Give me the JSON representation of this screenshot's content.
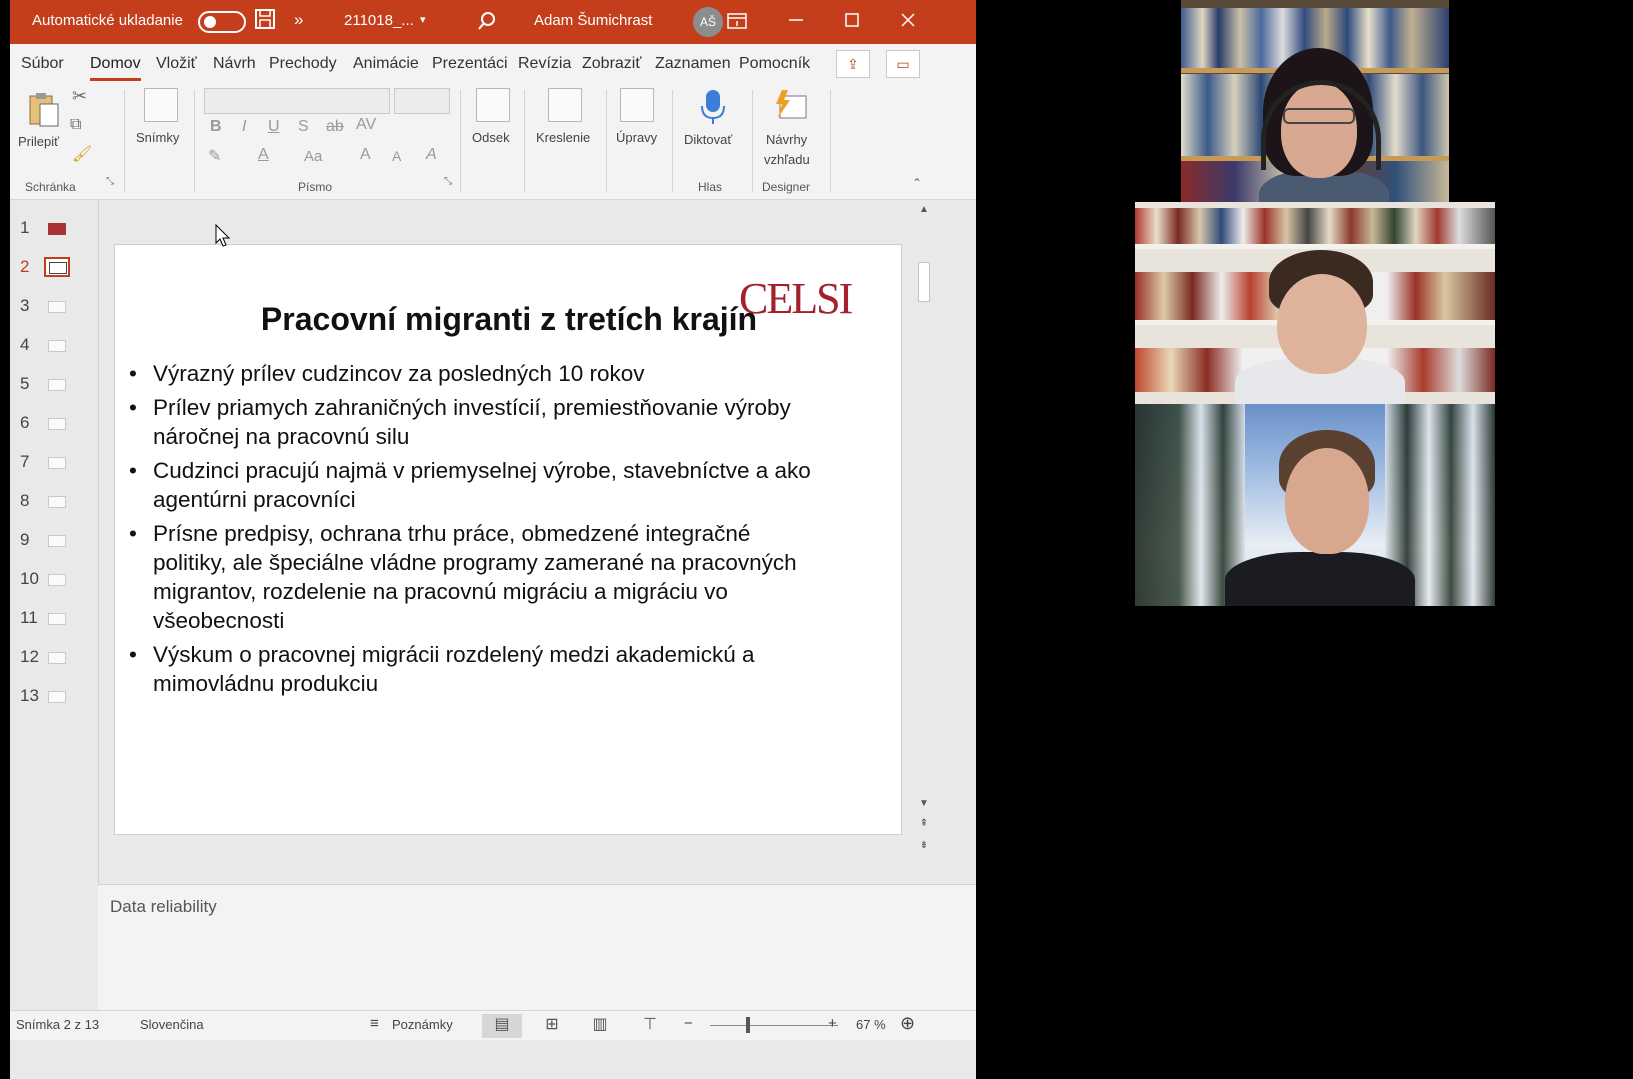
{
  "titlebar": {
    "autosave_label": "Automatické ukladanie",
    "more": "»",
    "filename": "211018_...",
    "filename_caret": "▾",
    "user_name": "Adam Šumichrast",
    "user_initials": "AŠ"
  },
  "tabs": [
    "Súbor",
    "Domov",
    "Vložiť",
    "Návrh",
    "Prechody",
    "Animácie",
    "Prezentáci",
    "Revízia",
    "Zobraziť",
    "Zaznamen",
    "Pomocník"
  ],
  "ribbon": {
    "paste_label": "Prilepiť",
    "clipboard_group": "Schránka",
    "slides_label": "Snímky",
    "font_group": "Písmo",
    "paragraph_label": "Odsek",
    "drawing_label": "Kreslenie",
    "editing_label": "Úpravy",
    "dictate_label": "Diktovať",
    "voice_group": "Hlas",
    "designer_label_1": "Návrhy",
    "designer_label_2": "vzhľadu",
    "designer_group": "Designer",
    "bold": "B",
    "italic": "I",
    "underline": "U",
    "shadow": "S",
    "strikethrough": "ab",
    "char_spacing": "AV",
    "change_case": "Aa",
    "grow_font": "A",
    "shrink_font": "A",
    "clear_format": "A"
  },
  "thumbnails": [
    {
      "num": "1",
      "style": "red"
    },
    {
      "num": "2",
      "style": "sel"
    },
    {
      "num": "3",
      "style": "plain"
    },
    {
      "num": "4",
      "style": "plain"
    },
    {
      "num": "5",
      "style": "plain"
    },
    {
      "num": "6",
      "style": "plain"
    },
    {
      "num": "7",
      "style": "plain"
    },
    {
      "num": "8",
      "style": "plain"
    },
    {
      "num": "9",
      "style": "plain"
    },
    {
      "num": "10",
      "style": "plain"
    },
    {
      "num": "11",
      "style": "plain"
    },
    {
      "num": "12",
      "style": "plain"
    },
    {
      "num": "13",
      "style": "plain"
    }
  ],
  "slide": {
    "title": "Pracovní migranti z tretích krajín",
    "logo": "CELSI",
    "bullets": [
      "Výrazný prílev cudzincov za posledných 10 rokov",
      "Prílev priamych zahraničných investícií, premiestňovanie výroby náročnej na pracovnú silu",
      "Cudzinci pracujú najmä v priemyselnej výrobe, stavebníctve a ako agentúrni pracovníci",
      "Prísne predpisy, ochrana trhu práce, obmedzené integračné politiky, ale špeciálne vládne programy zamerané na pracovných migrantov, rozdelenie na pracovnú migráciu a migráciu vo všeobecnosti",
      "Výskum o pracovnej migrácii rozdelený medzi akademickú a mimovládnu produkciu"
    ]
  },
  "notes": {
    "text": "Data reliability"
  },
  "status": {
    "slide_counter": "Snímka 2 z 13",
    "language": "Slovenčina",
    "notes_button": "Poznámky",
    "zoom_minus": "−",
    "zoom_plus": "+",
    "zoom_value": "67 %"
  },
  "colors": {
    "accent": "#c43e1c",
    "logo": "#a3202c"
  }
}
